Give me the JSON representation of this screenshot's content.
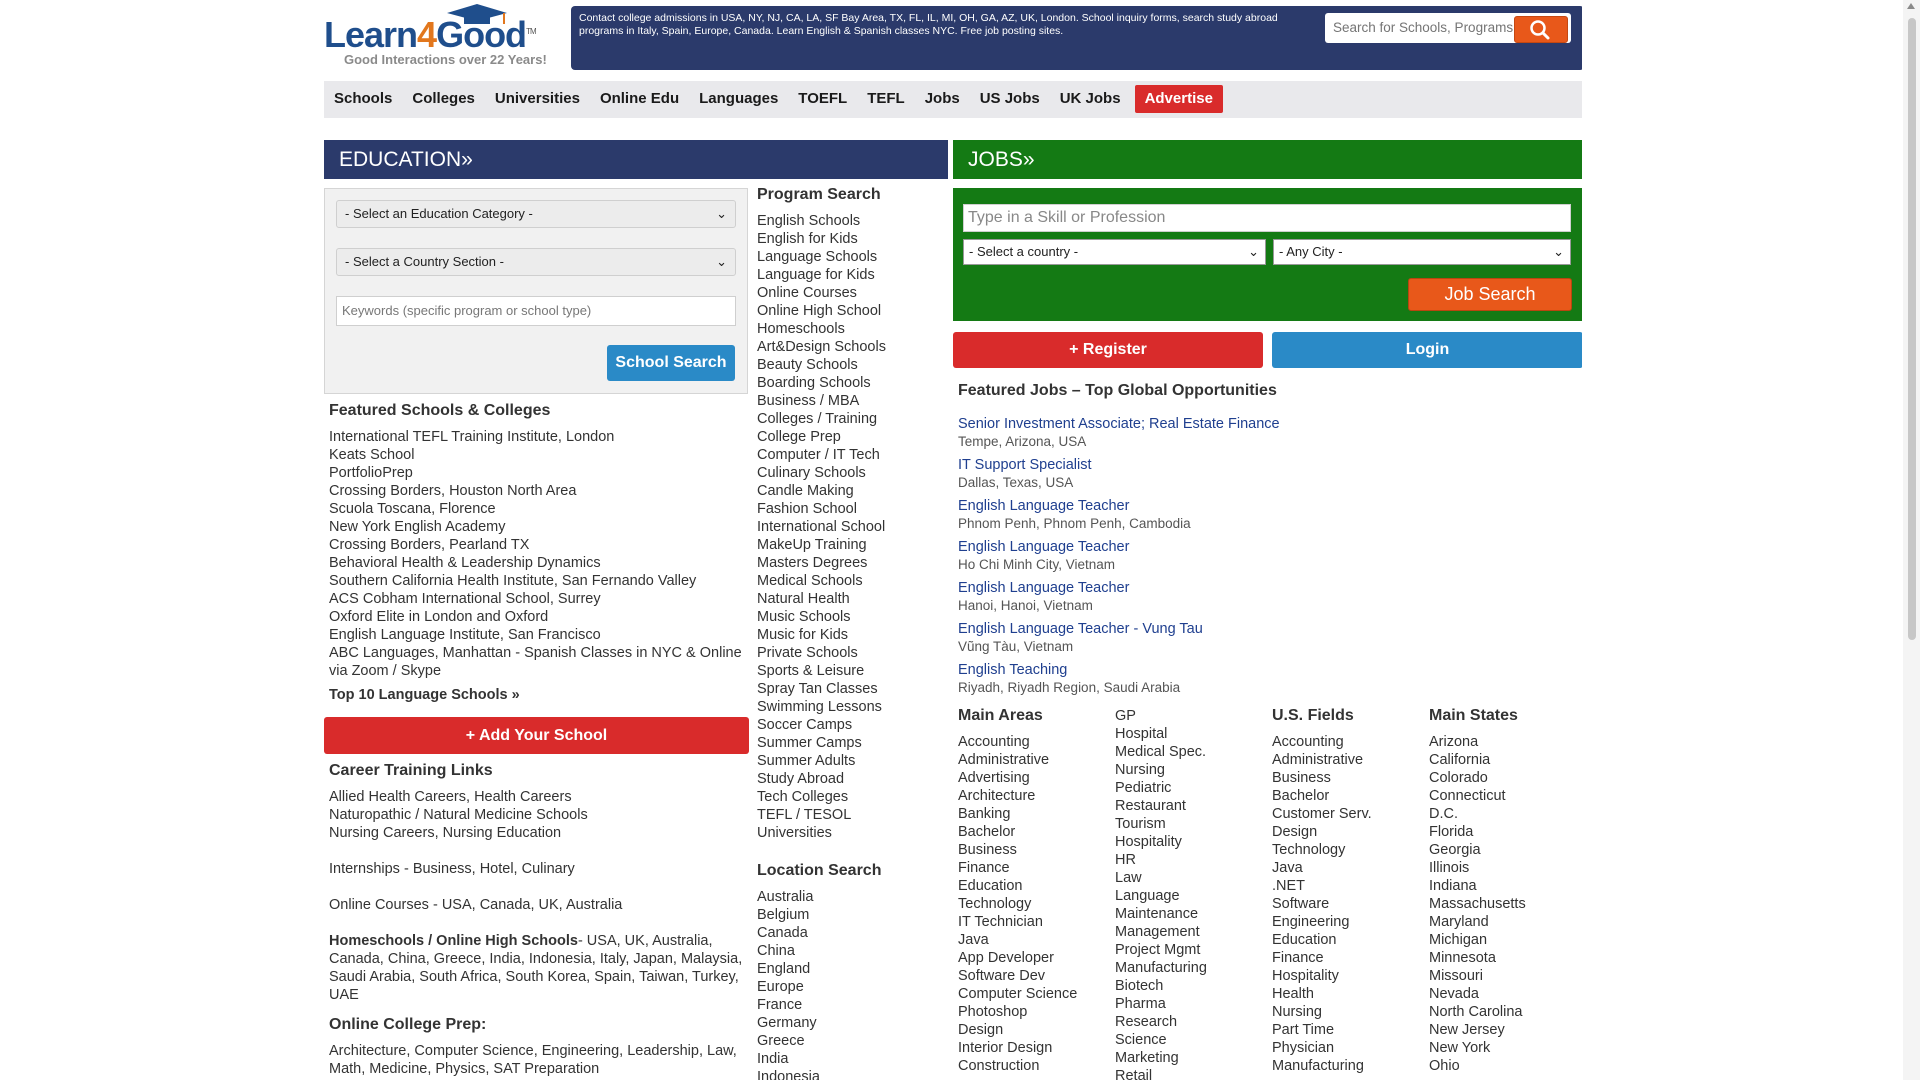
{
  "header": {
    "logo_text_a": "Learn",
    "logo_text_4": "4",
    "logo_text_b": "Good",
    "logo_tm": "TM",
    "tagline": "Good Interactions over 22 Years!",
    "info_text": "Contact college admissions in USA, NY, NJ, CA, LA, SF Bay Area, TX, FL, IL, MI, OH, GA, AZ, UK, London. School inquiry forms, search study abroad programs in Italy, Spain, Europe, Canada. Learn English & Spanish classes NYC. Free job posting sites.",
    "search_placeholder": "Search for Schools, Programs, J",
    "search_icon": "search-icon"
  },
  "nav": {
    "items": [
      "Schools",
      "Colleges",
      "Universities",
      "Online Edu",
      "Languages",
      "TOEFL",
      "TEFL",
      "Jobs",
      "US Jobs",
      "UK Jobs"
    ],
    "advertise": "Advertise"
  },
  "education": {
    "heading": "EDUCATION»",
    "category_select": "- Select an Education Category -",
    "country_select": "- Select a Country Section -",
    "keywords_placeholder": "Keywords (specific program or school type)",
    "search_button": "School Search",
    "featured_heading": "Featured Schools & Colleges",
    "featured": [
      "International TEFL Training Institute, London",
      "Keats School",
      "PortfolioPrep",
      "Crossing Borders, Houston North Area",
      "Scuola Toscana, Florence",
      "New York English Academy",
      "Crossing Borders, Pearland TX",
      "Behavioral Health & Leadership Dynamics",
      "Southern California Health Institute, San Fernando Valley",
      "ACS Cobham International School, Surrey",
      "Oxford Elite in London and Oxford",
      "English Language Institute, San Francisco",
      "ABC Languages, Manhattan - Spanish Classes in NYC & Online via Zoom / Skype"
    ],
    "top10": "Top 10 Language Schools »",
    "add_school": "+ Add Your School",
    "career_heading": "Career Training Links",
    "career_lines": [
      "Allied Health Careers, Health Careers",
      "Naturopathic / Natural Medicine Schools",
      "Nursing Careers, Nursing Education"
    ],
    "internships": "Internships - Business, Hotel, Culinary",
    "online_courses": "Online Courses - USA, Canada, UK, Australia",
    "homeschools_bold": "Homeschools / Online High Schools",
    "homeschools_rest": "- USA, UK, Australia, Canada, China, Greece, India, Indonesia, Italy, Japan, Malaysia, Saudi Arabia, South Africa, South Korea, Spain, Taiwan, Turkey, UAE",
    "college_prep_heading": "Online College Prep:",
    "college_prep_text": "Architecture, Computer Science, Engineering, Leadership, Law, Math, Medicine, Physics, SAT Preparation"
  },
  "program_search": {
    "heading": "Program Search",
    "items": [
      "English Schools",
      "English for Kids",
      "Language Schools",
      "Language for Kids",
      "Online Courses",
      "Online High School",
      "Homeschools",
      "Art&Design Schools",
      "Beauty Schools",
      "Boarding Schools",
      "Business / MBA",
      "Colleges / Training",
      "College Prep",
      "Computer / IT Tech",
      "Culinary Schools",
      "Candle Making",
      "Fashion School",
      "International School",
      "MakeUp Training",
      "Masters Degrees",
      "Medical Schools",
      "Natural Health",
      "Music Schools",
      "Music for Kids",
      "Private Schools",
      "Sports & Leisure",
      "Spray Tan Classes",
      "Swimming Lessons",
      "Soccer Camps",
      "Summer Camps",
      "Summer Adults",
      "Study Abroad",
      "Tech Colleges",
      "TEFL / TESOL",
      "Universities"
    ]
  },
  "location_search": {
    "heading": "Location Search",
    "items": [
      "Australia",
      "Belgium",
      "Canada",
      "China",
      "England",
      "Europe",
      "France",
      "Germany",
      "Greece",
      "India",
      "Indonesia"
    ]
  },
  "jobs": {
    "heading": "JOBS»",
    "skill_placeholder": "Type in a Skill or Profession",
    "country_select": "- Select a country -",
    "city_select": "- Any City -",
    "search_button": "Job Search",
    "register": "+ Register",
    "login": "Login",
    "featured_heading": "Featured Jobs – Top Global Opportunities",
    "featured": [
      {
        "title": "Senior Investment Associate; Real Estate Finance",
        "location": "Tempe, Arizona, USA"
      },
      {
        "title": "IT Support Specialist",
        "location": "Dallas, Texas, USA"
      },
      {
        "title": "English Language Teacher",
        "location": "Phnom Penh, Phnom Penh, Cambodia"
      },
      {
        "title": "English Language Teacher",
        "location": "Ho Chi Minh City, Vietnam"
      },
      {
        "title": "English Language Teacher",
        "location": "Hanoi, Hanoi, Vietnam"
      },
      {
        "title": "English Language Teacher - Vung Tau",
        "location": "Vũng Tàu, Vietnam"
      },
      {
        "title": "English Teaching",
        "location": "Riyadh, Riyadh Region, Saudi Arabia"
      }
    ],
    "main_areas_heading": "Main Areas",
    "main_areas": [
      "Accounting",
      "Administrative",
      "Advertising",
      "Architecture",
      "Banking",
      "Bachelor",
      "Business",
      "Finance",
      "Education",
      "Technology",
      "IT Technician",
      "Java",
      "App Developer",
      "Software Dev",
      "Computer Science",
      "Photoshop",
      "Design",
      "Interior Design",
      "Construction"
    ],
    "areas2": [
      "GP",
      "Hospital",
      "Medical Spec.",
      "Nursing",
      "Pediatric",
      "Restaurant",
      "Tourism",
      "Hospitality",
      "HR",
      "Law",
      "Language",
      "Maintenance",
      "Management",
      "Project Mgmt",
      "Manufacturing",
      "Biotech",
      "Pharma",
      "Research",
      "Science",
      "Marketing",
      "Retail"
    ],
    "us_fields_heading": "U.S. Fields",
    "us_fields": [
      "Accounting",
      "Administrative",
      "Business",
      "Bachelor",
      "Customer Serv.",
      "Design",
      "Technology",
      "Java",
      ".NET",
      "Software",
      "Engineering",
      "Education",
      "Finance",
      "Hospitality",
      "Health",
      "Nursing",
      "Part Time",
      "Physician",
      "Manufacturing"
    ],
    "main_states_heading": "Main States",
    "main_states": [
      "Arizona",
      "California",
      "Colorado",
      "Connecticut",
      "D.C.",
      "Florida",
      "Georgia",
      "Illinois",
      "Indiana",
      "Massachusetts",
      "Maryland",
      "Michigan",
      "Minnesota",
      "Missouri",
      "Nevada",
      "North Carolina",
      "New Jersey",
      "New York",
      "Ohio"
    ]
  },
  "colors": {
    "navy": "#2b3a6b",
    "green": "#147a14",
    "red": "#d92b2b",
    "blue": "#2a8ac7",
    "orange": "#e8581a"
  }
}
